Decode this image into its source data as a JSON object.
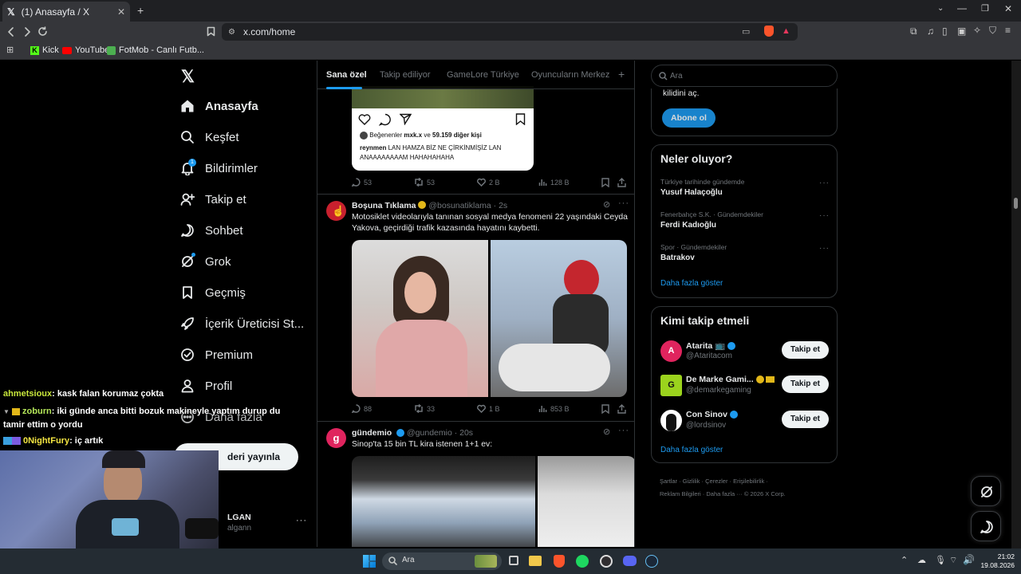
{
  "browser": {
    "tab_title": "(1) Anasayfa / X",
    "url": "x.com/home",
    "bookmarks": [
      "Kick",
      "YouTube",
      "FotMob - Canlı Futb..."
    ]
  },
  "nav": {
    "items": [
      {
        "label": "Anasayfa",
        "icon": "home-icon"
      },
      {
        "label": "Keşfet",
        "icon": "search-icon"
      },
      {
        "label": "Bildirimler",
        "icon": "bell-icon",
        "badge": "1"
      },
      {
        "label": "Takip et",
        "icon": "add-user-icon"
      },
      {
        "label": "Sohbet",
        "icon": "chat-icon"
      },
      {
        "label": "Grok",
        "icon": "grok-icon"
      },
      {
        "label": "Geçmiş",
        "icon": "bookmark-icon"
      },
      {
        "label": "İçerik Üreticisi St...",
        "icon": "rocket-icon"
      },
      {
        "label": "Premium",
        "icon": "verified-icon"
      },
      {
        "label": "Profil",
        "icon": "person-icon"
      },
      {
        "label": "Daha fazla",
        "icon": "more-icon"
      }
    ],
    "post_button": "Gönderi yayınla",
    "post_button_visible": "deri yayınla",
    "account_name_visible": "LGAN",
    "account_handle_visible": "algann"
  },
  "feed": {
    "tabs": [
      "Sana özel",
      "Takip ediliyor",
      "GameLore Türkiye",
      "Oyuncuların Merkezi"
    ],
    "tweet1": {
      "liked_by_user": "mxk.x",
      "liked_by_prefix": "Beğenenler",
      "liked_by_middle": "ve",
      "liked_by_others": "59.159 diğer kişi",
      "caption_user": "reynmen",
      "caption_text": "LAN HAMZA BİZ NE ÇİRKİNMİŞİZ LAN ANAAAAAAAAM HAHAHAHAHA",
      "replies": "53",
      "reposts": "53",
      "likes": "2 B",
      "views": "128 B"
    },
    "tweet2": {
      "name": "Boşuna Tıklama",
      "handle": "@bosunatiklama",
      "time": "· 2s",
      "text": "Motosiklet videolarıyla tanınan sosyal medya fenomeni 22 yaşındaki Ceyda Yakova, geçirdiği trafik kazasında hayatını kaybetti.",
      "replies": "88",
      "reposts": "33",
      "likes": "1 B",
      "views": "853 B"
    },
    "tweet3": {
      "name": "gündemio",
      "handle": "@gundemio",
      "time": "· 20s",
      "text": "Sinop'ta 15 bin TL kira istenen 1+1 ev:"
    }
  },
  "right": {
    "search_placeholder": "Ara",
    "premium_text": "kilidini aç.",
    "subscribe_button": "Abone ol",
    "trends_title": "Neler oluyor?",
    "trends": [
      {
        "category": "Türkiye tarihinde gündemde",
        "name": "Yusuf Halaçoğlu"
      },
      {
        "category": "Fenerbahçe S.K. · Gündemdekiler",
        "name": "Ferdi Kadıoğlu"
      },
      {
        "category": "Spor · Gündemdekiler",
        "name": "Batrakov"
      }
    ],
    "show_more": "Daha fazla göster",
    "who_title": "Kimi takip etmeli",
    "who": [
      {
        "name": "Atarita",
        "handle": "@Ataritacom",
        "avatar_color": "#e0245e"
      },
      {
        "name": "De Marke Gami...",
        "handle": "@demarkegaming",
        "avatar_color": "#9bd31d"
      },
      {
        "name": "Con Sinov",
        "handle": "@lordsinov",
        "avatar_color": "#ffffff"
      }
    ],
    "follow_label": "Takip et",
    "footer": [
      "Şartlar",
      "Gizlilik",
      "Çerezler",
      "Erişilebilirlik",
      "Reklam Bilgileri",
      "Daha fazla ···",
      "© 2026 X Corp."
    ]
  },
  "chat": [
    {
      "user": "ahmetsioux",
      "message": ": kask falan korumaz çokta",
      "color": "#c8e63c"
    },
    {
      "user": "zoburn",
      "message": ": iki günde anca bitti bozuk makineyle yaptım durup du",
      "color": "#b6e85a"
    },
    {
      "user": "",
      "message": "tamir ettim o yordu",
      "color": "#ffffff"
    },
    {
      "user": "0NightFury",
      "message": ": iç artık",
      "color": "#f5e642"
    }
  ],
  "taskbar": {
    "search": "Ara",
    "time": "21:02",
    "date": "19.08.2026"
  },
  "colors": {
    "accent": "#1d9bf0",
    "bg": "#000000",
    "taskbar": "#242c33"
  }
}
